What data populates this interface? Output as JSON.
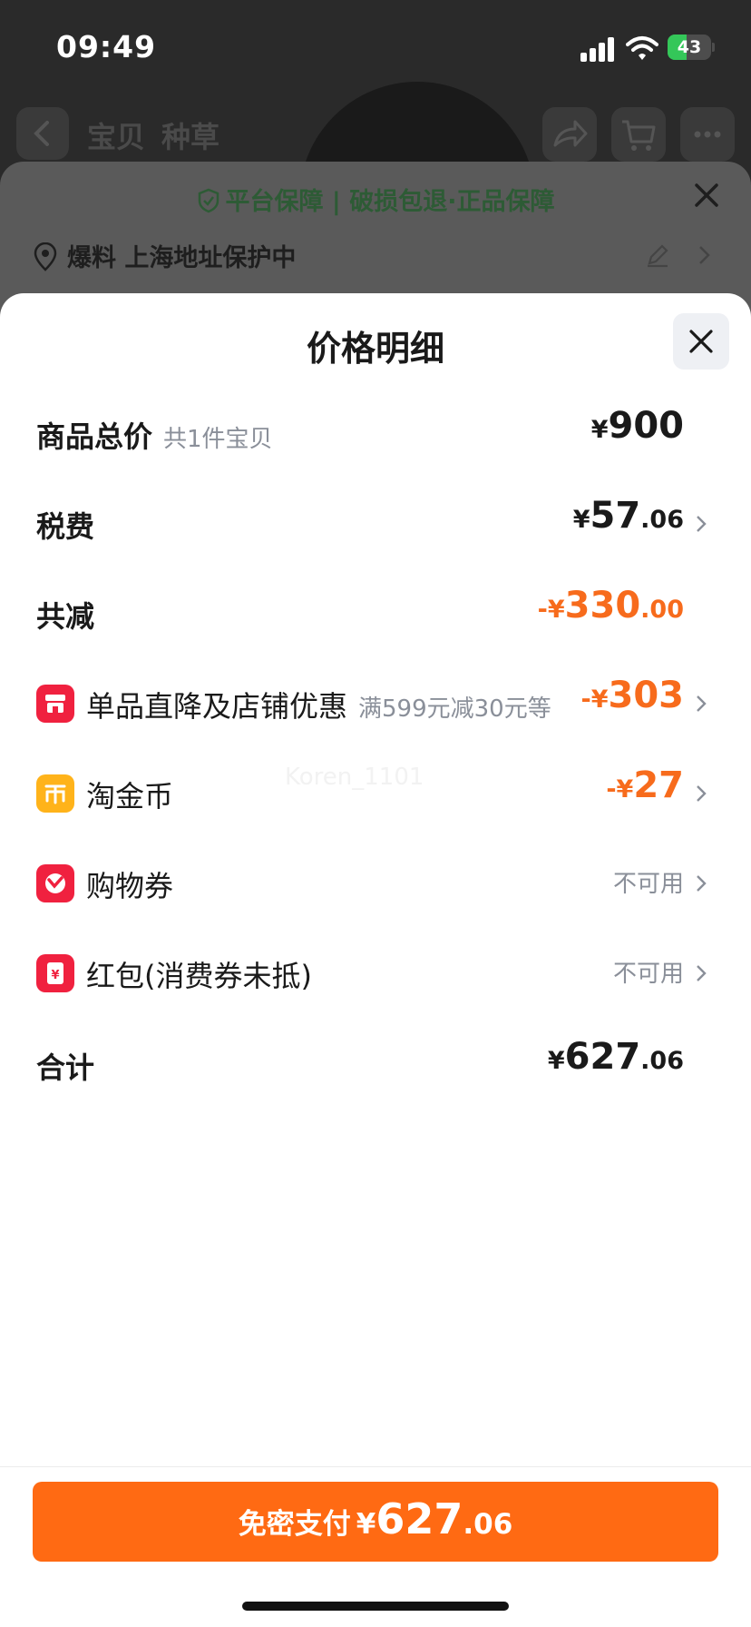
{
  "status_bar": {
    "time": "09:49",
    "battery": "43",
    "battery_fraction": 0.43
  },
  "background": {
    "nav_tabs": [
      "宝贝",
      "种草"
    ],
    "guarantee": "平台保障 | 破损包退·正品保障",
    "address": "爆料 上海地址保护中"
  },
  "sheet": {
    "title": "价格明细",
    "watermark": "Koren_1101",
    "rows": [
      {
        "label": "商品总价",
        "sub": "共1件宝贝",
        "currency": "¥",
        "int": "900",
        "dec": ""
      },
      {
        "label": "税费",
        "currency": "¥",
        "int": "57",
        "dec": ".06"
      },
      {
        "label": "共减",
        "currency": "-¥",
        "int": "330",
        "dec": ".00"
      },
      {
        "label": "单品直降及店铺优惠",
        "sub": "满599元减30元等",
        "currency": "-¥",
        "int": "303",
        "dec": "",
        "icon": "shop-icon"
      },
      {
        "label": "淘金币",
        "currency": "-¥",
        "int": "27",
        "dec": "",
        "icon": "coin-icon"
      },
      {
        "label": "购物券",
        "status": "不可用",
        "icon": "coupon-icon"
      },
      {
        "label": "红包(消费券未抵)",
        "status": "不可用",
        "icon": "red-packet-icon"
      },
      {
        "label": "合计",
        "currency": "¥",
        "int": "627",
        "dec": ".06"
      }
    ]
  },
  "pay_button": {
    "label": "免密支付",
    "currency": "¥",
    "int": "627",
    "dec": ".06"
  },
  "colors": {
    "accent": "#ff6a13",
    "discount": "#f76b1c",
    "icon_red": "#f0213f",
    "icon_yellow": "#ffb31a"
  }
}
